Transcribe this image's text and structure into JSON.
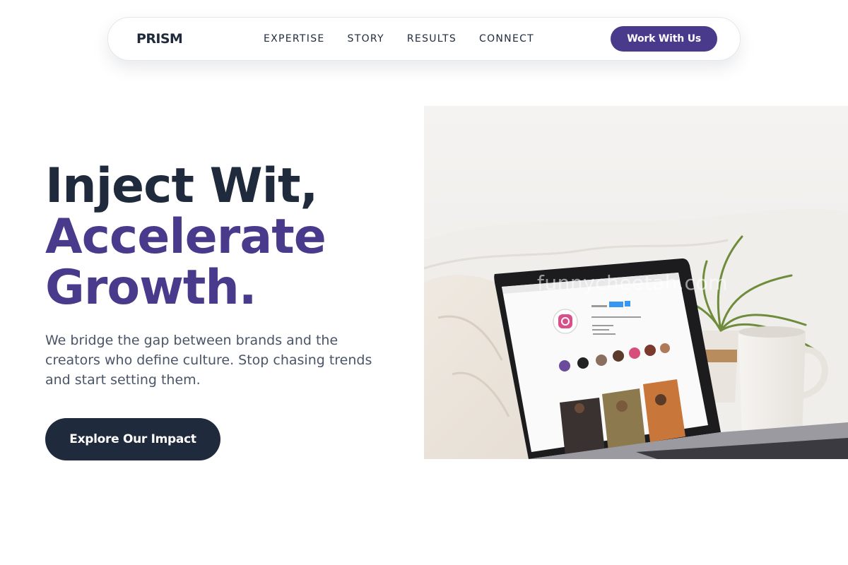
{
  "nav": {
    "logo": "PRISM",
    "links": [
      "EXPERTISE",
      "STORY",
      "RESULTS",
      "CONNECT"
    ],
    "cta_label": "Work With Us"
  },
  "hero": {
    "title_line1": "Inject Wit,",
    "title_line2": "Accelerate",
    "title_line3": "Growth.",
    "subtitle": "We bridge the gap between brands and the creators who define culture. Stop chasing trends and start setting them.",
    "cta_label": "Explore Our Impact"
  },
  "image": {
    "watermark": "funnycheetah.com",
    "screen_app": "Instagram"
  },
  "colors": {
    "brand_purple": "#4a3a8c",
    "dark_navy": "#1f2a3c",
    "body_gray": "#4a5568"
  }
}
